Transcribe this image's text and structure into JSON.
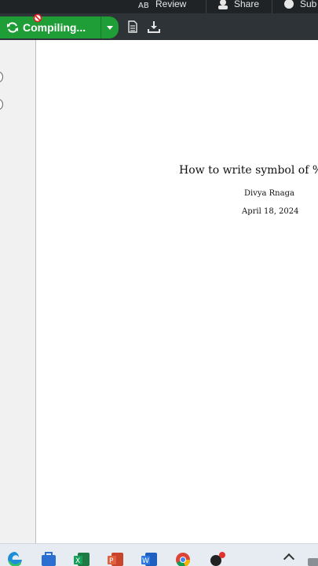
{
  "header": {
    "review_label": "Review",
    "share_label": "Share",
    "submit_label": "Sub"
  },
  "toolbar": {
    "compile_label": "Compiling..."
  },
  "document": {
    "title": "How to write symbol of %",
    "author": "Divya Rnaga",
    "date": "April 18, 2024"
  },
  "colors": {
    "compile_green": "#1f9d37",
    "toolbar_bg": "#2d3336",
    "topbar_bg": "#1f2326"
  },
  "taskbar": {
    "apps": [
      "edge-icon",
      "store-icon",
      "excel-icon",
      "powerpoint-icon",
      "word-icon",
      "chrome-icon",
      "app-icon"
    ]
  }
}
